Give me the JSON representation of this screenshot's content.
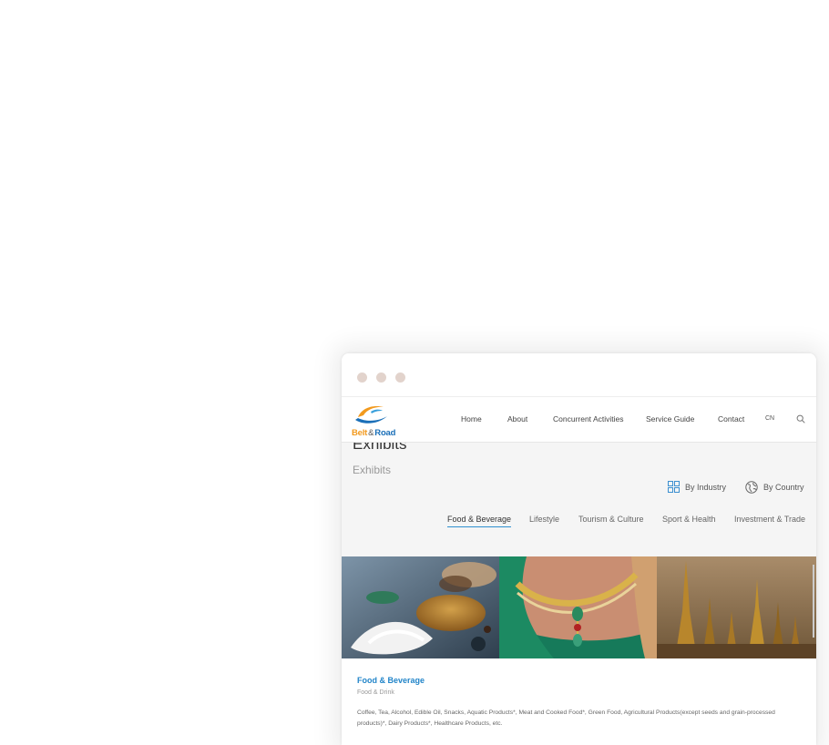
{
  "logo": {
    "part1": "Belt",
    "amp": "&",
    "part2": "Road"
  },
  "nav": {
    "items": [
      "Home",
      "About",
      "Concurrent Activities",
      "Service Guide",
      "Contact"
    ],
    "lang": "CN"
  },
  "page": {
    "title": "Exhibits",
    "subtitle": "Exhibits"
  },
  "filters": {
    "by_industry": "By Industry",
    "by_country": "By Country"
  },
  "tabs": [
    "Food & Beverage",
    "Lifestyle",
    "Tourism & Culture",
    "Sport & Health",
    "Investment & Trade"
  ],
  "active_tab": "Food & Beverage",
  "card": {
    "title": "Food & Beverage",
    "subtitle": "Food & Drink",
    "description": "Coffee, Tea, Alcohol, Edible Oil, Snacks, Aquatic Products*, Meat and Cooked Food*, Green Food, Agricultural Products(except seeds and grain-processed products)*, Dairy Products*, Healthcare Products, etc."
  },
  "colors": {
    "accent": "#2285c9",
    "logo_orange": "#f29a1e",
    "logo_blue": "#1a6fb8",
    "window_dot": "#e2d3cc"
  }
}
